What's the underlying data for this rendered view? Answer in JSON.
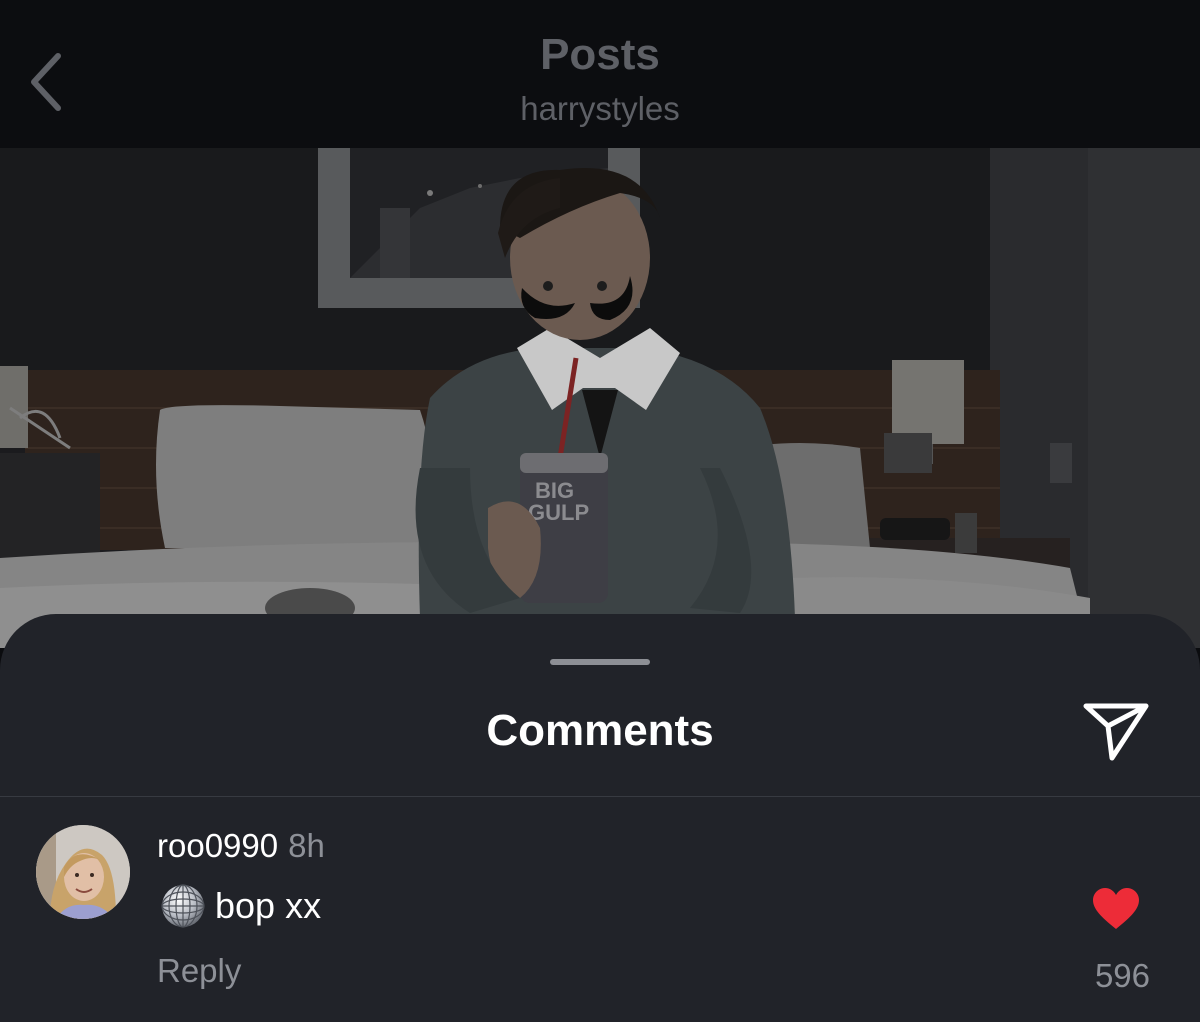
{
  "header": {
    "back_icon": "chevron-left-icon",
    "title": "Posts",
    "subtitle": "harrystyles"
  },
  "post": {
    "photo_icon": "post-photo"
  },
  "comments_sheet": {
    "title": "Comments",
    "share_icon": "paper-plane-icon"
  },
  "comments": [
    {
      "username": "roo0990",
      "timestamp": "8h",
      "emoji_icon": "disco-ball-icon",
      "text": "bop xx",
      "reply_label": "Reply",
      "liked": true,
      "like_icon": "heart-icon",
      "like_count": "596"
    }
  ],
  "colors": {
    "header_bg": "#0c0d10",
    "header_text": "#5e6066",
    "sheet_bg": "#212329",
    "primary_text": "#ffffff",
    "secondary_text": "#8d9097",
    "like_red": "#ed2c38"
  }
}
